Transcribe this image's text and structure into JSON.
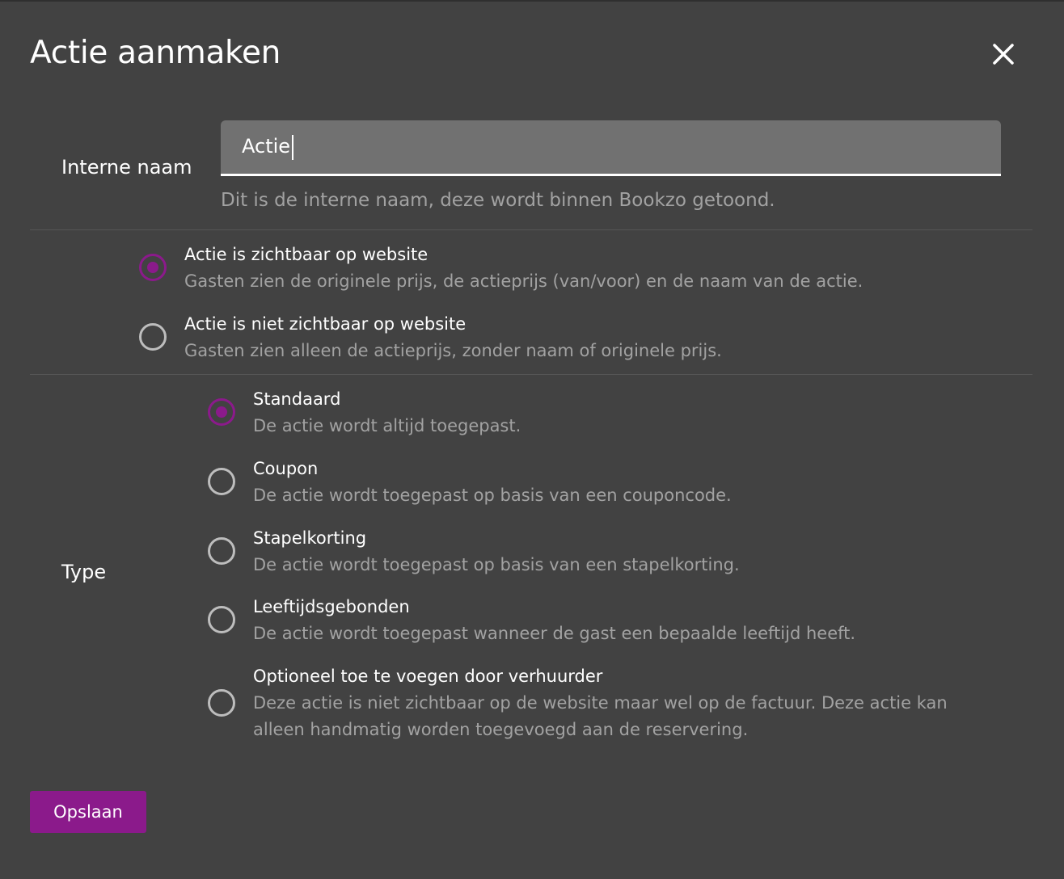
{
  "dialog": {
    "title": "Actie aanmaken",
    "close_icon": "close-icon"
  },
  "internal_name": {
    "label": "Interne naam",
    "value": "Actie",
    "hint": "Dit is de interne naam, deze wordt binnen Bookzo getoond."
  },
  "visibility": {
    "options": [
      {
        "title": "Actie is zichtbaar op website",
        "description": "Gasten zien de originele prijs, de actieprijs (van/voor) en de naam van de actie.",
        "selected": true
      },
      {
        "title": "Actie is niet zichtbaar op website",
        "description": "Gasten zien alleen de actieprijs, zonder naam of originele prijs.",
        "selected": false
      }
    ]
  },
  "type": {
    "label": "Type",
    "options": [
      {
        "title": "Standaard",
        "description": "De actie wordt altijd toegepast.",
        "selected": true
      },
      {
        "title": "Coupon",
        "description": "De actie wordt toegepast op basis van een couponcode.",
        "selected": false
      },
      {
        "title": "Stapelkorting",
        "description": "De actie wordt toegepast op basis van een stapelkorting.",
        "selected": false
      },
      {
        "title": "Leeftijdsgebonden",
        "description": "De actie wordt toegepast wanneer de gast een bepaalde leeftijd heeft.",
        "selected": false
      },
      {
        "title": "Optioneel toe te voegen door verhuurder",
        "description": "Deze actie is niet zichtbaar op de website maar wel op de factuur. Deze actie kan alleen handmatig worden toegevoegd aan de reservering.",
        "selected": false
      }
    ]
  },
  "actions": {
    "save_label": "Opslaan"
  },
  "colors": {
    "background": "#424242",
    "accent": "#8b1a8b",
    "input_background": "#717171",
    "muted_text": "#a2a2a2"
  }
}
